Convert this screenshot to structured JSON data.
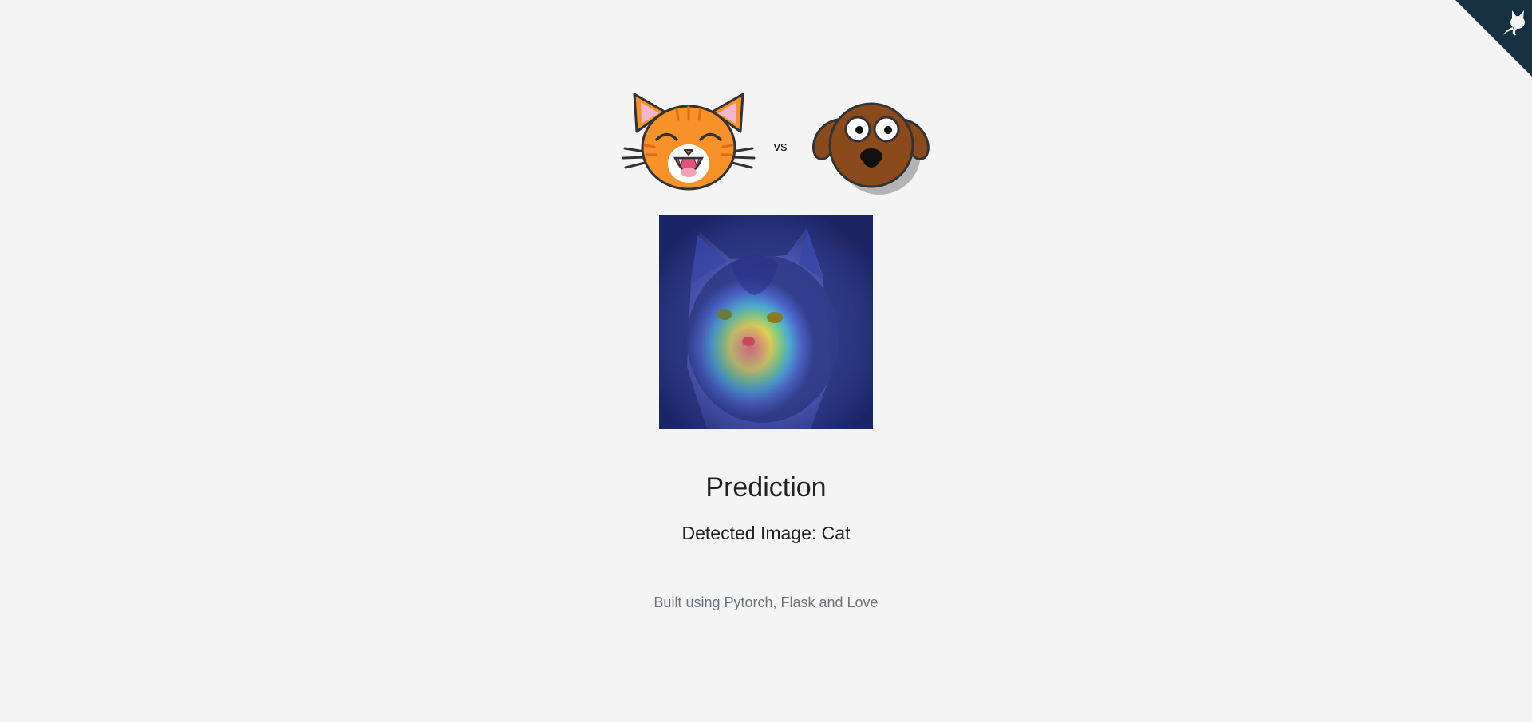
{
  "header": {
    "vs_label": "vs"
  },
  "result": {
    "title": "Prediction",
    "detected": "Detected Image: Cat"
  },
  "footer": {
    "text": "Built using Pytorch, Flask and Love"
  },
  "icons": {
    "corner": "github-octocat-icon",
    "cat": "cat-face-icon",
    "dog": "dog-face-icon"
  },
  "colors": {
    "corner": "#17303f",
    "background": "#f4f4f4",
    "cat_orange": "#f7922a",
    "dog_brown": "#8b4a1c"
  }
}
